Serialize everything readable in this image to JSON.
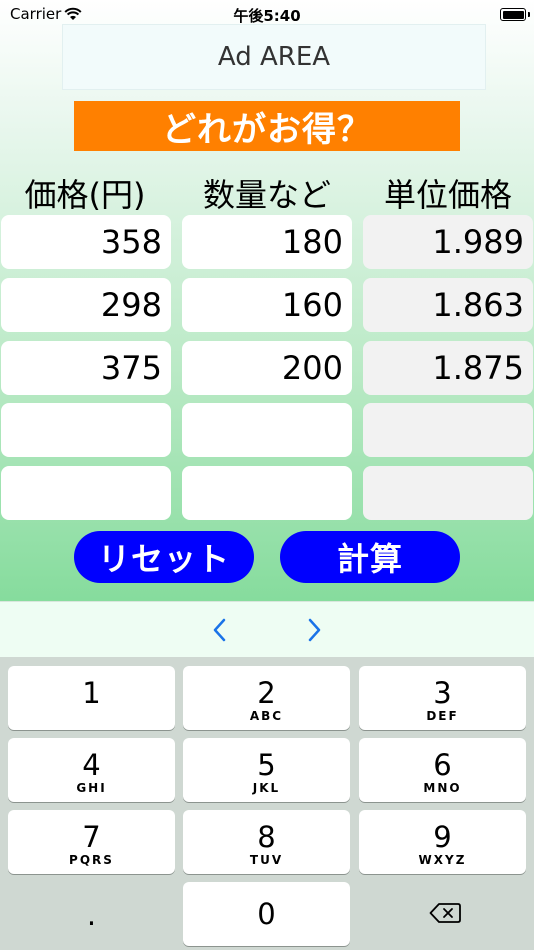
{
  "status": {
    "carrier": "Carrier",
    "time": "午後5:40"
  },
  "ad": {
    "label": "Ad AREA"
  },
  "title": "どれがお得？",
  "headers": [
    "価格(円)",
    "数量など",
    "単位価格"
  ],
  "rows": [
    [
      "358",
      "180",
      "1.989"
    ],
    [
      "298",
      "160",
      "1.863"
    ],
    [
      "375",
      "200",
      "1.875"
    ],
    [
      "",
      "",
      ""
    ],
    [
      "",
      "",
      ""
    ]
  ],
  "buttons": {
    "reset": "リセット",
    "calc": "計算"
  },
  "keyboard": {
    "keys": [
      {
        "digit": "1",
        "letters": ""
      },
      {
        "digit": "2",
        "letters": "ABC"
      },
      {
        "digit": "3",
        "letters": "DEF"
      },
      {
        "digit": "4",
        "letters": "GHI"
      },
      {
        "digit": "5",
        "letters": "JKL"
      },
      {
        "digit": "6",
        "letters": "MNO"
      },
      {
        "digit": "7",
        "letters": "PQRS"
      },
      {
        "digit": "8",
        "letters": "TUV"
      },
      {
        "digit": "9",
        "letters": "WXYZ"
      }
    ],
    "decimal": ".",
    "zero": "0"
  },
  "colors": {
    "title_bg": "#ff8000",
    "button_bg": "#0000ff",
    "nav_chevron": "#1a73e8"
  },
  "icons": [
    "wifi-icon",
    "battery-icon",
    "chevron-left-icon",
    "chevron-right-icon",
    "delete-backspace-icon"
  ]
}
